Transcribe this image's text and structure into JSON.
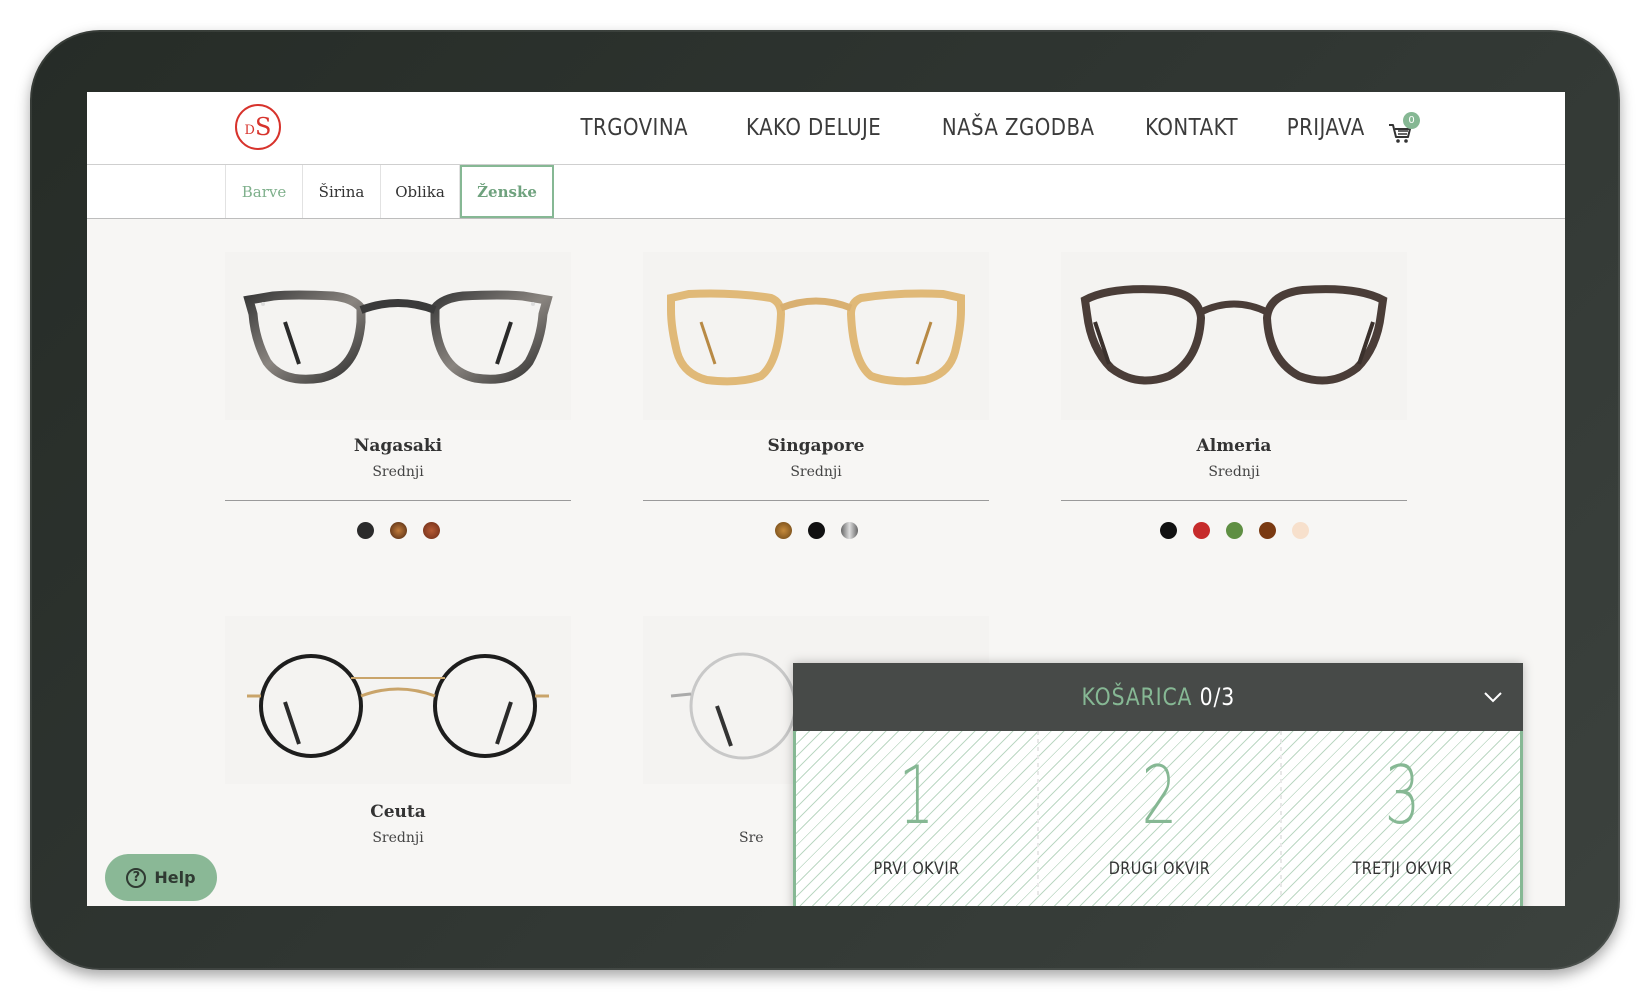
{
  "brand": {
    "logo_small": "D",
    "logo_big": "S",
    "color": "#d7332c"
  },
  "nav": {
    "items": [
      "TRGOVINA",
      "KAKO DELUJE",
      "NAŠA ZGODBA",
      "KONTAKT",
      "PRIJAVA"
    ],
    "cart_count": "0",
    "cart_icon": "shopping-cart-icon"
  },
  "filters": [
    "Barve",
    "Širina",
    "Oblika",
    "Ženske"
  ],
  "products": [
    {
      "name": "Nagasaki",
      "width": "Srednji",
      "colors": [
        "#2b2b2b",
        "#6b3a1a",
        "#8a3a22"
      ]
    },
    {
      "name": "Singapore",
      "width": "Srednji",
      "colors": [
        "#9a6a2a",
        "#111111",
        "#a8a8a8"
      ]
    },
    {
      "name": "Almeria",
      "width": "Srednji",
      "colors": [
        "#111111",
        "#c62b2b",
        "#5f8f43",
        "#7a3a12",
        "#f7e0cc"
      ]
    },
    {
      "name": "Ceuta",
      "width": "Srednji",
      "colors": []
    },
    {
      "name": "",
      "width": "Sre",
      "colors": []
    }
  ],
  "cart_panel": {
    "title": "KOŠARICA",
    "count": "0/3",
    "slots": [
      {
        "number": "1",
        "label": "PRVI OKVIR"
      },
      {
        "number": "2",
        "label": "DRUGI OKVIR"
      },
      {
        "number": "3",
        "label": "TRETJI OKVIR"
      }
    ]
  },
  "help": {
    "label": "Help"
  },
  "accent_color": "#86b894"
}
